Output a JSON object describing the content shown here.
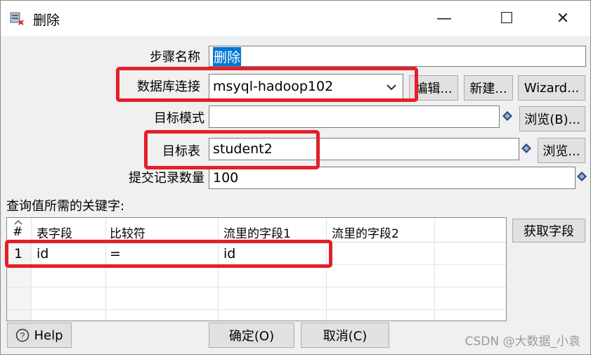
{
  "window": {
    "title": "删除",
    "icon": "delete-step-icon"
  },
  "window_controls": {
    "minimize": "—",
    "maximize": "☐",
    "close": "✕"
  },
  "form": {
    "step_name": {
      "label": "步骤名称",
      "value": "删除"
    },
    "db_connection": {
      "label": "数据库连接",
      "value": "msyql-hadoop102",
      "edit_label": "编辑...",
      "new_label": "新建...",
      "wizard_label": "Wizard..."
    },
    "target_schema": {
      "label": "目标模式",
      "value": "",
      "browse_label": "浏览(B)..."
    },
    "target_table": {
      "label": "目标表",
      "value": "student2",
      "browse_label": "浏览..."
    },
    "commit_size": {
      "label": "提交记录数量",
      "value": "100"
    }
  },
  "keys": {
    "label": "查询值所需的关键字:",
    "columns": [
      "#",
      "表字段",
      "比较符",
      "流里的字段1",
      "流里的字段2"
    ],
    "rows": [
      {
        "num": "1",
        "table_field": "id",
        "comparator": "=",
        "stream_field1": "id",
        "stream_field2": ""
      }
    ],
    "get_fields_label": "获取字段"
  },
  "footer": {
    "help_label": "Help",
    "ok_label": "确定(O)",
    "cancel_label": "取消(C)"
  },
  "watermark": "CSDN @大数据_小袁",
  "colors": {
    "highlight_red": "#e3202a",
    "selection_blue": "#0078d7"
  }
}
